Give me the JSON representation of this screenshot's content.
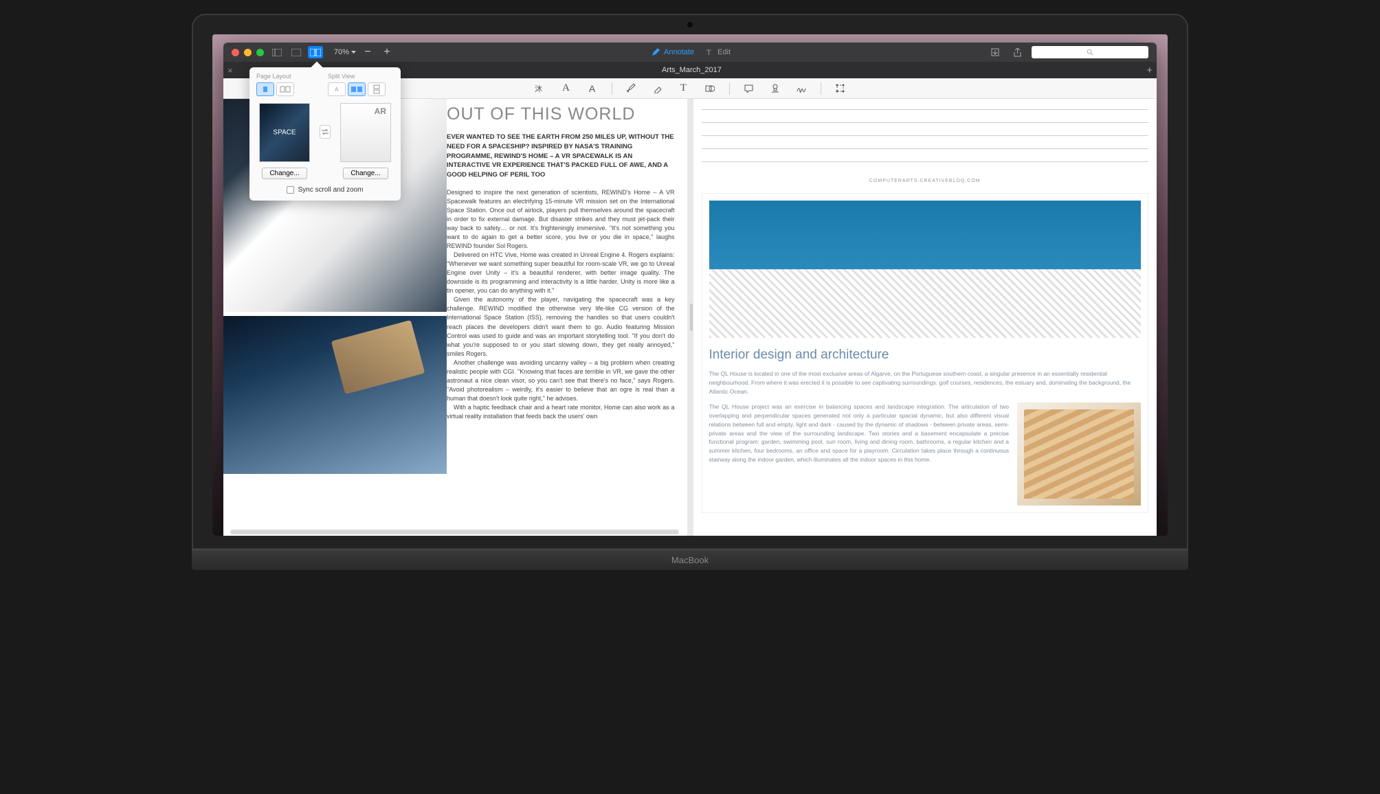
{
  "toolbar": {
    "zoom": "70%",
    "annotate": "Annotate",
    "edit": "Edit"
  },
  "tab": {
    "title": "Arts_March_2017"
  },
  "popover": {
    "page_layout_label": "Page Layout",
    "split_view_label": "Split View",
    "change_left": "Change...",
    "change_right": "Change...",
    "sync_label": "Sync scroll and zoom"
  },
  "left_article": {
    "title": "OUT OF THIS WORLD",
    "intro": "EVER WANTED TO SEE THE EARTH FROM 250 MILES UP, WITHOUT THE NEED FOR A SPACESHIP? INSPIRED BY NASA'S TRAINING PROGRAMME, REWIND'S HOME – A VR SPACEWALK IS AN INTERACTIVE VR EXPERIENCE THAT'S PACKED FULL OF AWE, AND A GOOD HELPING OF PERIL TOO",
    "p1": "Designed to inspire the next generation of scientists, REWIND's Home – A VR Spacewalk features an electrifying 15-minute VR mission set on the International Space Station. Once out of airlock, players pull themselves around the spacecraft in order to fix external damage. But disaster strikes and they must jet-pack their way back to safety… or not. It's frighteningly immersive. \"It's not something you want to do again to get a better score, you live or you die in space,\" laughs REWIND founder Sol Rogers.",
    "p2": "Delivered on HTC Vive, Home was created in Unreal Engine 4. Rogers explains: \"Whenever we want something super beautiful for room-scale VR, we go to Unreal Engine over Unity – it's a beautiful renderer, with better image quality. The downside is its programming and interactivity is a little harder. Unity is more like a tin opener, you can do anything with it.\"",
    "p3": "Given the autonomy of the player, navigating the spacecraft was a key challenge. REWIND modified the otherwise very life-like CG version of the International Space Station (ISS), removing the handles so that users couldn't reach places the developers didn't want them to go. Audio featuring Mission Control was used to guide and was an important storytelling tool. \"If you don't do what you're supposed to or you start slowing down, they get really annoyed,\" smiles Rogers.",
    "p4": "Another challenge was avoiding uncanny valley – a big problem when creating realistic people with CGI. \"Knowing that faces are terrible in VR, we gave the other astronaut a nice clean visor, so you can't see that there's no face,\" says Rogers. \"Avoid photorealism – weirdly, it's easier to believe that an ogre is real than a human that doesn't look quite right,\" he advises.",
    "p5": "With a haptic feedback chair and a heart rate monitor, Home can also work as a virtual reality installation that feeds back the users' own"
  },
  "right_article": {
    "caption": "COMPUTERARTS.CREATIVEBLOQ.COM",
    "title": "Interior design and architecture",
    "intro": "The QL House is located in one of the most exclusive areas of Algarve, on the Portuguese southern coast, a singular presence in an essentially residential neighbourhood. From where it was erected it is possible to see captivating surroundings: golf courses, residences, the estuary and, dominating the background, the Atlantic Ocean.",
    "body": "The QL House project was an exercise in balancing spaces and landscape integration. The articulation of two overlapping and perpendicular spaces generated not only a particular spacial dynamic, but also different visual relations between full and empty, light and dark - caused by the dynamic of shadows - between private areas, semi-private areas and the view of the surrounding landscape.\n\nTwo stories and a basement encapsulate a precise functional program: garden, swimming pool, sun room, living and dining room, bathrooms, a regular kitchen and a summer kitchen, four bedrooms, an office and space for a playroom. Circulation takes place through a continuous stairway along the indoor garden, which illuminates all the indoor spaces in this home."
  },
  "device": "MacBook"
}
